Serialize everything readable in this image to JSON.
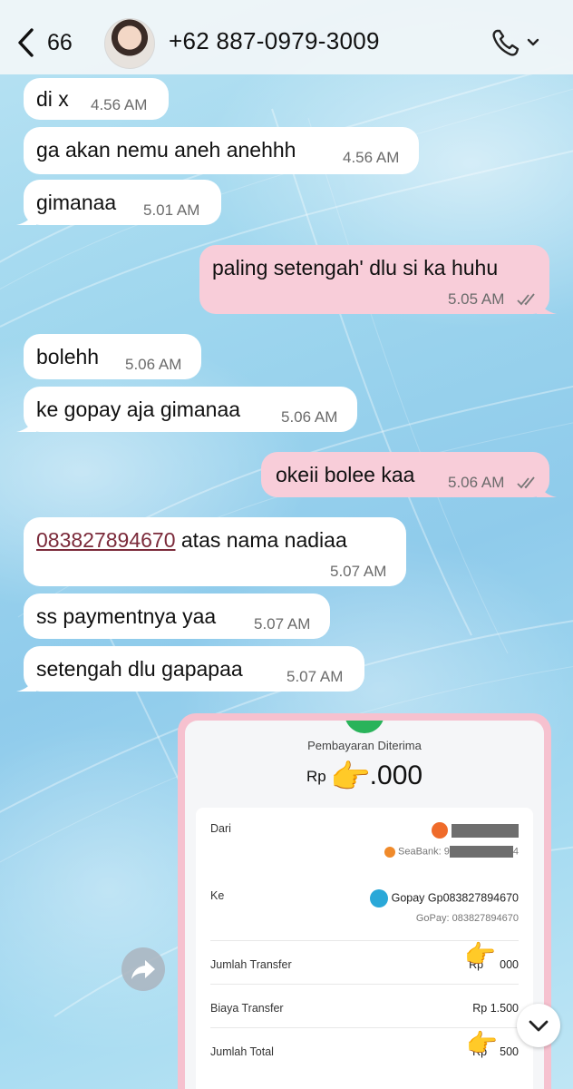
{
  "header": {
    "back_count": "66",
    "contact_phone": "+62 887-0979-3009"
  },
  "messages": [
    {
      "dir": "in",
      "text": "di x",
      "time": "4.56 AM"
    },
    {
      "dir": "in",
      "text": "ga akan nemu aneh anehhh",
      "time": "4.56 AM"
    },
    {
      "dir": "in",
      "text": "gimanaa",
      "time": "5.01 AM"
    },
    {
      "dir": "out",
      "text": "paling setengah' dlu si ka huhu",
      "time": "5.05 AM",
      "status": "read"
    },
    {
      "dir": "in",
      "text": "bolehh",
      "time": "5.06 AM"
    },
    {
      "dir": "in",
      "text": "ke gopay aja gimanaa",
      "time": "5.06 AM"
    },
    {
      "dir": "out",
      "text": "okeii bolee kaa",
      "time": "5.06 AM",
      "status": "read"
    },
    {
      "dir": "in",
      "link": "083827894670",
      "text": " atas nama nadiaa",
      "time": "5.07 AM"
    },
    {
      "dir": "in",
      "text": "ss paymentnya yaa",
      "time": "5.07 AM"
    },
    {
      "dir": "in",
      "text": "setengah dlu gapapaa",
      "time": "5.07 AM"
    }
  ],
  "receipt": {
    "title": "Pembayaran Diterima",
    "amount_prefix": "Rp",
    "amount_visible": ".000",
    "from_label": "Dari",
    "from_bank": "SeaBank: 9",
    "from_bank_tail": "4",
    "to_label": "Ke",
    "to_name": "Gopay Gp083827894670",
    "to_sub": "GoPay: 083827894670",
    "transfer_label": "Jumlah Transfer",
    "transfer_value_prefix": "Rp",
    "transfer_value_tail": "000",
    "fee_label": "Biaya Transfer",
    "fee_value": "Rp 1.500",
    "total_label": "Jumlah Total",
    "total_value_prefix": "Rp",
    "total_value_tail": "500"
  },
  "colors": {
    "incoming_bubble": "#ffffff",
    "outgoing_bubble": "#f8cdd9",
    "receipt_border": "#f6c1cf",
    "link": "#7b2a3a"
  },
  "icons": [
    "back-chevron-icon",
    "phone-icon",
    "chevron-down-icon",
    "double-check-icon",
    "forward-icon",
    "scroll-down-icon",
    "pointing-hand-emoji"
  ]
}
